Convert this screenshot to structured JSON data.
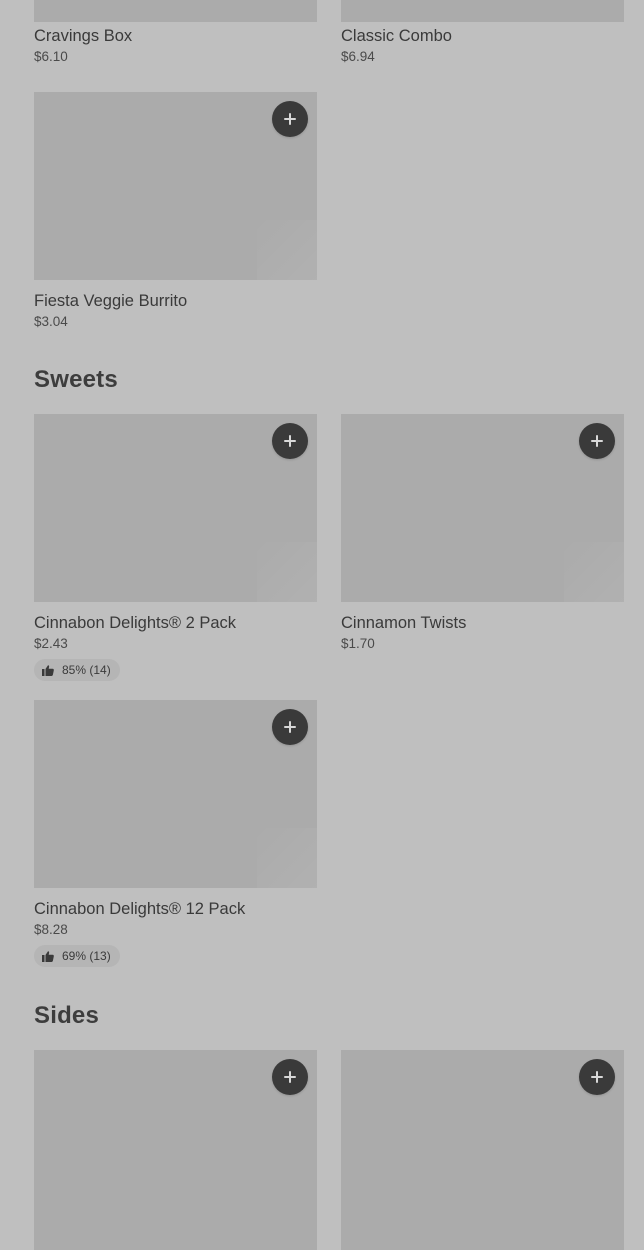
{
  "top_items": [
    {
      "name": "Cravings Box",
      "price": "$6.10"
    },
    {
      "name": "Classic Combo",
      "price": "$6.94"
    }
  ],
  "previous_section": {
    "items": [
      {
        "name": "Fiesta Veggie Burrito",
        "price": "$3.04"
      }
    ]
  },
  "sweets": {
    "title": "Sweets",
    "items": [
      {
        "name": "Cinnabon Delights® 2 Pack",
        "price": "$2.43",
        "rating": "85% (14)"
      },
      {
        "name": "Cinnamon Twists",
        "price": "$1.70"
      },
      {
        "name": "Cinnabon Delights® 12 Pack",
        "price": "$8.28",
        "rating": "69% (13)"
      }
    ]
  },
  "sides": {
    "title": "Sides"
  },
  "icons": {
    "add": "plus-icon",
    "rating": "thumbs-up-icon"
  },
  "colors": {
    "background": "#bfbfbf",
    "image_placeholder": "#ababab",
    "add_button": "#3a3a3a"
  }
}
